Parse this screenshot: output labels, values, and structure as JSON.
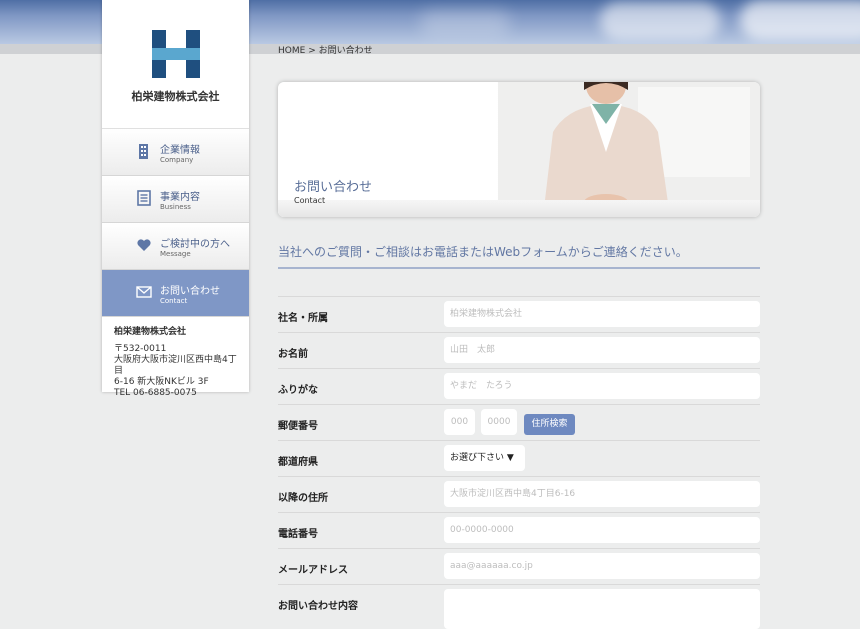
{
  "breadcrumb": {
    "home": "HOME",
    "separator": ">",
    "current": "お問い合わせ"
  },
  "brand": {
    "logo_icon": "h-letter-logo-icon",
    "company_name": "柏栄建物株式会社",
    "colors": {
      "primary": "#1f4f7f",
      "accent": "#5aa7cf"
    }
  },
  "nav": [
    {
      "icon": "building-icon",
      "jp": "企業情報",
      "en": "Company",
      "active": false
    },
    {
      "icon": "document-icon",
      "jp": "事業内容",
      "en": "Business",
      "active": false
    },
    {
      "icon": "heart-icon",
      "jp": "ご検討中の方へ",
      "en": "Message",
      "active": false
    },
    {
      "icon": "mail-icon",
      "jp": "お問い合わせ",
      "en": "Contact",
      "active": true
    }
  ],
  "address": {
    "name": "柏栄建物株式会社",
    "postal": "〒532-0011",
    "line1": "大阪府大阪市淀川区西中島4丁目",
    "line2": "6-16 新大阪NKビル 3F",
    "tel": "TEL 06-6885-0075"
  },
  "hero": {
    "title_jp": "お問い合わせ",
    "title_en": "Contact"
  },
  "lead": "当社へのご質問・ご相談はお電話またはWebフォームからご連絡ください。",
  "form": {
    "company": {
      "label": "社名・所属",
      "placeholder": "柏栄建物株式会社"
    },
    "name": {
      "label": "お名前",
      "placeholder": "山田　太郎"
    },
    "furigana": {
      "label": "ふりがな",
      "placeholder": "やまだ　たろう"
    },
    "postal": {
      "label": "郵便番号",
      "placeholder1": "000",
      "placeholder2": "0000",
      "search_button": "住所検索"
    },
    "prefecture": {
      "label": "都道府県",
      "selected": "お選び下さい ▼"
    },
    "address": {
      "label": "以降の住所",
      "placeholder": "大阪市淀川区西中島4丁目6-16"
    },
    "phone": {
      "label": "電話番号",
      "placeholder": "00-0000-0000"
    },
    "email": {
      "label": "メールアドレス",
      "placeholder": "aaa@aaaaaa.co.jp"
    },
    "inquiry": {
      "label": "お問い合わせ内容"
    }
  }
}
